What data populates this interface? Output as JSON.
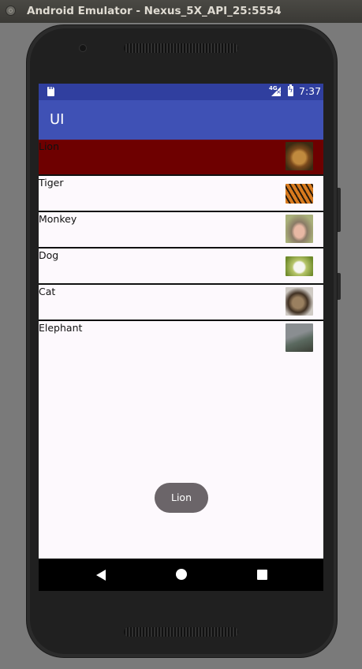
{
  "window": {
    "title": "Android Emulator - Nexus_5X_API_25:5554"
  },
  "statusbar": {
    "network": "4G",
    "time": "7:37"
  },
  "appbar": {
    "title": "UI"
  },
  "animals": [
    {
      "label": "Lion",
      "selected": true,
      "thumb": "lion-image"
    },
    {
      "label": "Tiger",
      "selected": false,
      "thumb": "tiger-image"
    },
    {
      "label": "Monkey",
      "selected": false,
      "thumb": "monkey-image"
    },
    {
      "label": "Dog",
      "selected": false,
      "thumb": "dog-image"
    },
    {
      "label": "Cat",
      "selected": false,
      "thumb": "cat-image"
    },
    {
      "label": "Elephant",
      "selected": false,
      "thumb": "elephant-image"
    }
  ],
  "toast": {
    "text": "Lion"
  },
  "navbar": {
    "icons": [
      "back-icon",
      "home-icon",
      "recents-icon"
    ]
  },
  "colors": {
    "status_bar": "#303f9f",
    "app_bar": "#3f51b5",
    "selected_row": "#6e0000"
  }
}
